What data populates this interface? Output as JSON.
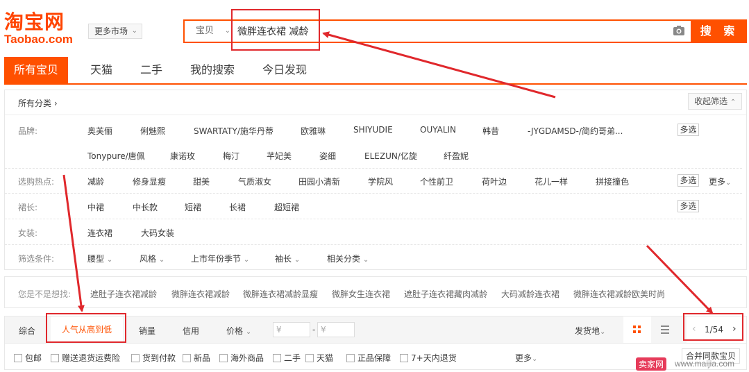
{
  "logo": {
    "cn": "淘宝网",
    "en": "Taobao.com"
  },
  "market_button": "更多市场",
  "search": {
    "type": "宝贝",
    "value": "微胖连衣裙 减龄",
    "button": "搜 索"
  },
  "tabs": [
    "所有宝贝",
    "天猫",
    "二手",
    "我的搜索",
    "今日发现"
  ],
  "category": {
    "all_label": "所有分类",
    "collapse": "收起筛选",
    "rows": [
      {
        "label": "品牌:",
        "items": [
          "奥芙俪",
          "俐魅熙",
          "SWARTATY/施华丹蒂",
          "欧雅琳",
          "SHIYUDIE",
          "OUYALIN",
          "韩昔",
          "-JYGDAMSD-/简约哥弟...",
          "Tonypure/唐佩",
          "康诺玫",
          "梅汀",
          "芊妃美",
          "姿细",
          "ELEZUN/亿旋",
          "纤盈妮"
        ],
        "multi": "多选"
      },
      {
        "label": "选购热点:",
        "items": [
          "减龄",
          "修身显瘦",
          "甜美",
          "气质淑女",
          "田园小清新",
          "学院风",
          "个性前卫",
          "荷叶边",
          "花儿一样",
          "拼接撞色"
        ],
        "multi": "多选",
        "more": "更多"
      },
      {
        "label": "裙长:",
        "items": [
          "中裙",
          "中长款",
          "短裙",
          "长裙",
          "超短裙"
        ],
        "multi": "多选"
      },
      {
        "label": "女装:",
        "items": [
          "连衣裙",
          "大码女装"
        ]
      },
      {
        "label": "筛选条件:",
        "items": [
          "腰型",
          "风格",
          "上市年份季节",
          "袖长",
          "相关分类"
        ]
      }
    ]
  },
  "guess": {
    "label": "您是不是想找:",
    "items": [
      "遮肚子连衣裙减龄",
      "微胖连衣裙减龄",
      "微胖连衣裙减龄显瘦",
      "微胖女生连衣裙",
      "遮肚子连衣裙藏肉减龄",
      "大码减龄连衣裙",
      "微胖连衣裙减龄欧美时尚"
    ]
  },
  "sort": {
    "items": [
      "综合",
      "人气从高到低",
      "销量",
      "信用",
      "价格"
    ],
    "price_from": "¥",
    "price_to": "¥",
    "dash": "-",
    "ship_from": "发货地",
    "page": "1/54"
  },
  "filters": {
    "items": [
      "包邮",
      "赠送退货运费险",
      "货到付款",
      "新品",
      "海外商品",
      "二手",
      "天猫",
      "正品保障",
      "7+天内退货"
    ],
    "more": "更多",
    "merge": "合并同款宝贝"
  },
  "watermark": {
    "logo": "卖家网",
    "url": "www.maijia.com"
  },
  "colors": {
    "accent": "#ff5000",
    "annotation": "#e0282c"
  }
}
